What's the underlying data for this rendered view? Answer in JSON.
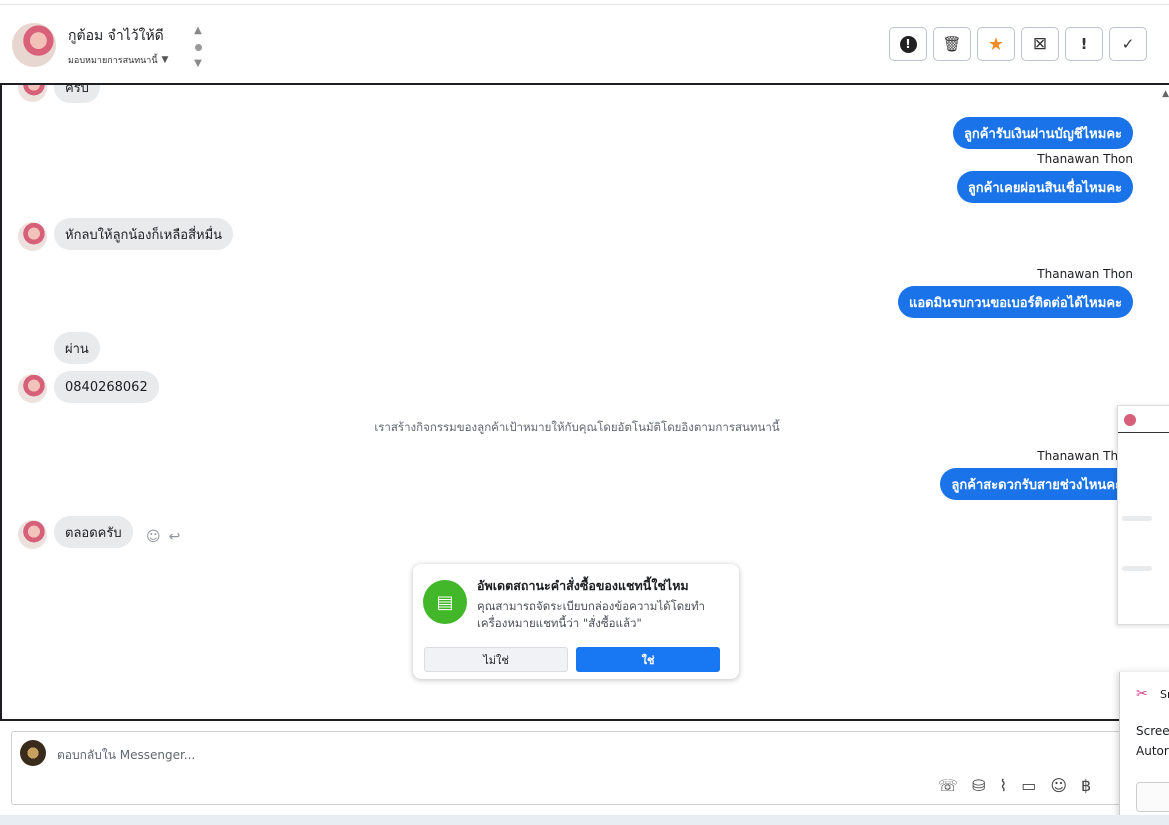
{
  "header": {
    "contact_name": "กูต้อม จำไว้ให้ดี",
    "assign_label": "มอบหมายการสนทนานี้",
    "toolbar_icons": [
      "report-icon",
      "trash-icon",
      "star-icon",
      "archive-icon",
      "exclamation-icon",
      "check-icon"
    ],
    "toolbar_glyphs": [
      "!",
      "🗑",
      "★",
      "⊠",
      "!",
      "✓"
    ]
  },
  "messages": {
    "m0": "ครับ",
    "m1": "ลูกค้ารับเงินผ่านบัญชีไหมคะ",
    "sender1": "Thanawan Thon",
    "m2": "ลูกค้าเคยผ่อนสินเชื่อไหมคะ",
    "m3": "หักลบให้ลูกน้องก็เหลือสี่หมื่น",
    "sender2": "Thanawan Thon",
    "m4": "แอดมินรบกวนขอเบอร์ติดต่อได้ไหมคะ",
    "m5": "ผ่าน",
    "m6": "0840268062",
    "system": "เราสร้างกิจกรรมของลูกค้าเป้าหมายให้กับคุณโดยอัตโนมัติโดยอิงตามการสนทนานี้",
    "sender3": "Thanawan Thon",
    "m7": "ลูกค้าสะดวกรับสายช่วงไหนคะ",
    "m8": "ตลอดครับ"
  },
  "popup": {
    "title": "อัพเดตสถานะคำสั่งซื้อของแชทนี้ใช่ไหม",
    "body": "คุณสามารถจัดระเบียบกล่องข้อความได้โดยทำเครื่องหมายแชทนี้ว่า \"สั่งซื้อแล้ว\"",
    "no_label": "ไม่ใช่",
    "yes_label": "ใช่"
  },
  "compose": {
    "placeholder": "ตอบกลับใน Messenger..."
  },
  "snip": {
    "title": "Sn",
    "line1": "Scree",
    "line2": "Autor"
  }
}
